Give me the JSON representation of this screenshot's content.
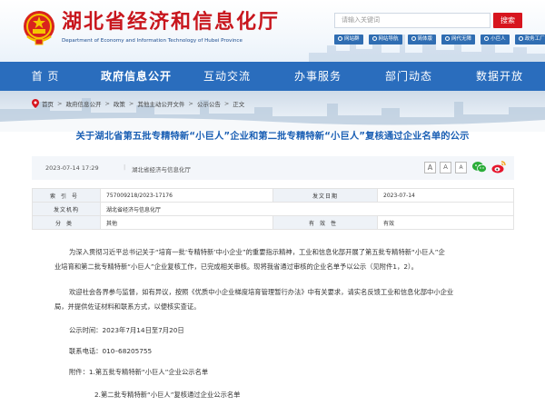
{
  "header": {
    "site_title": "湖北省经济和信息化厅",
    "site_subtitle": "Department of Economy and Information Technology of Hubei Province",
    "search_placeholder": "请输入关键词",
    "search_button": "搜索",
    "quick_links": [
      "网站群",
      "网站导航",
      "简体版",
      "网代无障",
      "小巨人",
      "政务工厂"
    ]
  },
  "nav": {
    "items": [
      "首 页",
      "政府信息公开",
      "互动交流",
      "办事服务",
      "部门动态",
      "数据开放"
    ],
    "active_index": 1
  },
  "breadcrumb": {
    "items": [
      "首页",
      "政府信息公开",
      "政策",
      "其他主动公开文件",
      "公示公告",
      "正文"
    ],
    "separator": ">"
  },
  "article": {
    "title": "关于湖北省第五批专精特新“小巨人”企业和第二批专精特新“小巨人”复核通过企业名单的公示",
    "date": "2023-07-14 17:29",
    "source": "湖北省经济与信息化厅",
    "font_sizes": [
      "A",
      "A",
      "A"
    ],
    "share_icons": [
      "wechat-icon",
      "weibo-icon"
    ]
  },
  "info_table": {
    "rows": [
      {
        "label1": "索引号",
        "value1": "757009218/2023-17176",
        "label2": "发文日期",
        "value2": "2023-07-14"
      },
      {
        "label1": "发文机构",
        "value1": "湖北省经济与信息化厅",
        "label2": "",
        "value2": ""
      },
      {
        "label1": "分类",
        "value1": "其他",
        "label2": "有效性",
        "value2": "有效"
      }
    ]
  },
  "body": {
    "paragraphs": [
      "为深入贯彻习近平总书记关于“培育一批‘专精特新’中小企业”的重要指示精神，工业和信息化部开展了第五批专精特新“小巨人”企",
      "业培育和第二批专精特新“小巨人”企业复核工作，已完成相关审核。现将我省通过审核的企业名单予以公示（见附件1，2）。",
      "欢迎社会各界参与监督，如有异议，按照《优质中小企业梯度培育管理暂行办法》中有关要求，请实名反馈工业和信息化部中小企业",
      "局，并提供佐证材料和联系方式，以便核实查证。",
      "公示时间：2023年7月14日至7月20日",
      "联系电话：010–68205755",
      "附件：1.第五批专精特新“小巨人”企业公示名单",
      "2.第二批专精特新“小巨人”复核通过企业公示名单"
    ]
  },
  "colors": {
    "brand_red": "#c8161d",
    "nav_blue": "#2a6dbd",
    "title_blue": "#1a5fb4",
    "search_red": "#d7151e"
  }
}
